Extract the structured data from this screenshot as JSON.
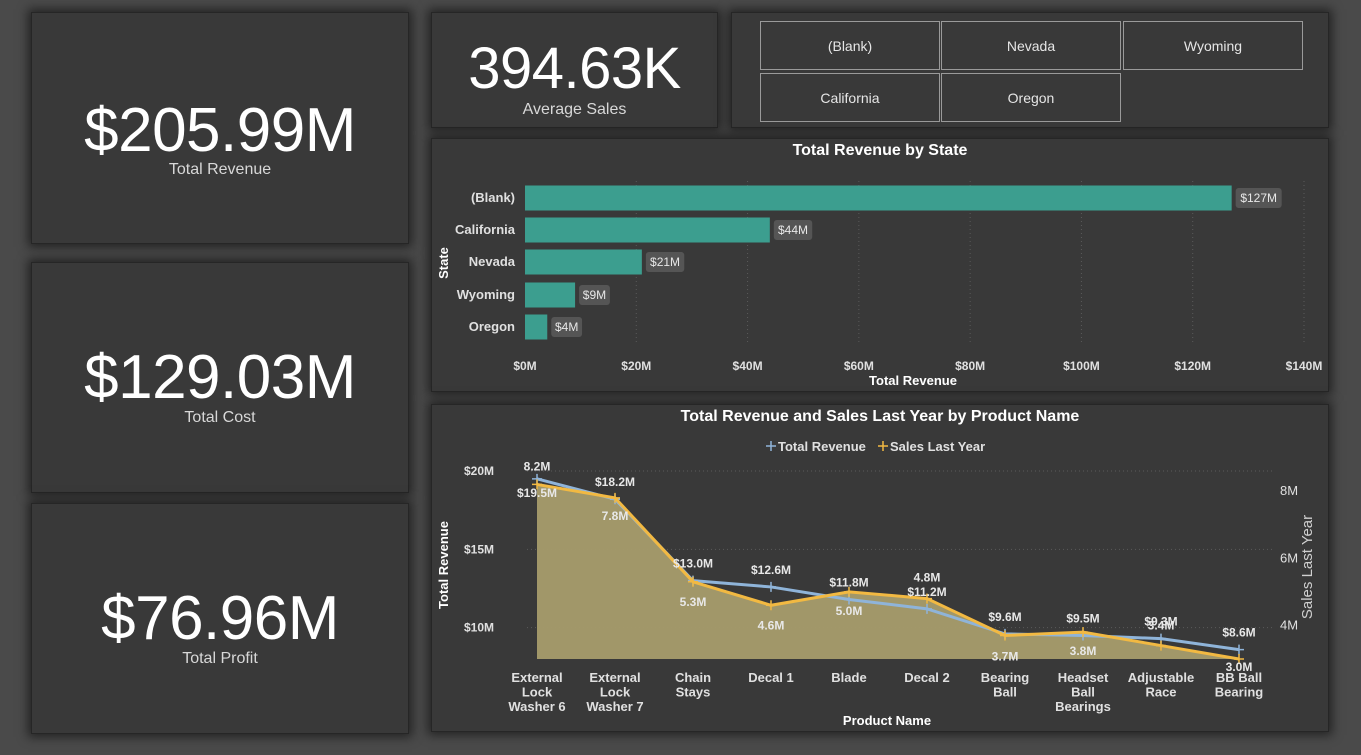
{
  "kpis": {
    "revenue": {
      "value": "$205.99M",
      "label": "Total Revenue"
    },
    "cost": {
      "value": "$129.03M",
      "label": "Total Cost"
    },
    "profit": {
      "value": "$76.96M",
      "label": "Total Profit"
    },
    "avg_sales": {
      "value": "394.63K",
      "label": "Average Sales"
    }
  },
  "slicer": {
    "items": [
      "(Blank)",
      "Nevada",
      "Wyoming",
      "California",
      "Oregon"
    ]
  },
  "colors": {
    "bar": "#3c9e8f",
    "revenue_line": "#8fb4d9",
    "sales_line": "#f2b942",
    "area_fill": "#a69c6c",
    "tile_bg": "#393939",
    "page_bg": "#4a4a4a"
  },
  "chart_data": [
    {
      "type": "bar",
      "orientation": "horizontal",
      "title": "Total Revenue by State",
      "xlabel": "Total Revenue",
      "ylabel": "State",
      "categories": [
        "(Blank)",
        "California",
        "Nevada",
        "Wyoming",
        "Oregon"
      ],
      "values": [
        127,
        44,
        21,
        9,
        4
      ],
      "data_labels": [
        "$127M",
        "$44M",
        "$21M",
        "$9M",
        "$4M"
      ],
      "xlim": [
        0,
        140
      ],
      "xticks": [
        "$0M",
        "$20M",
        "$40M",
        "$60M",
        "$80M",
        "$100M",
        "$120M",
        "$140M"
      ],
      "grid": true
    },
    {
      "type": "line",
      "title": "Total Revenue and Sales Last Year by Product Name",
      "xlabel": "Product Name",
      "ylabel": "Total Revenue",
      "ylabel_right": "Sales Last Year",
      "legend": "top-center",
      "categories": [
        "External Lock Washer 6",
        "External Lock Washer 7",
        "Chain Stays",
        "Decal 1",
        "Blade",
        "Decal 2",
        "Bearing Ball",
        "Headset Ball Bearings",
        "Adjustable Race",
        "BB Ball Bearing"
      ],
      "category_lines": [
        [
          "External",
          "Lock",
          "Washer 6"
        ],
        [
          "External",
          "Lock",
          "Washer 7"
        ],
        [
          "Chain",
          "Stays"
        ],
        [
          "Decal 1"
        ],
        [
          "Blade"
        ],
        [
          "Decal 2"
        ],
        [
          "Bearing",
          "Ball"
        ],
        [
          "Headset",
          "Ball",
          "Bearings"
        ],
        [
          "Adjustable",
          "Race"
        ],
        [
          "BB Ball",
          "Bearing"
        ]
      ],
      "yticks_left": [
        "$20M",
        "$15M",
        "$10M"
      ],
      "yticks_right": [
        "8M",
        "6M",
        "4M"
      ],
      "ylim_left": [
        8,
        20
      ],
      "ylim_right": [
        3,
        8.6
      ],
      "series": [
        {
          "name": "Total Revenue",
          "axis": "left",
          "values": [
            19.5,
            18.2,
            13.0,
            12.6,
            11.8,
            11.2,
            9.6,
            9.5,
            9.3,
            8.6
          ],
          "labels": [
            "$19.5M",
            "$18.2M",
            "$13.0M",
            "$12.6M",
            "$11.8M",
            "$11.2M",
            "$9.6M",
            "$9.5M",
            "$9.3M",
            "$8.6M"
          ]
        },
        {
          "name": "Sales Last Year",
          "axis": "right",
          "values": [
            8.2,
            7.8,
            5.3,
            4.6,
            5.0,
            4.8,
            3.7,
            3.8,
            3.4,
            3.0
          ],
          "labels": [
            "8.2M",
            "7.8M",
            "5.3M",
            "4.6M",
            "5.0M",
            "4.8M",
            "3.7M",
            "3.8M",
            "3.4M",
            "3.0M"
          ]
        }
      ]
    }
  ]
}
